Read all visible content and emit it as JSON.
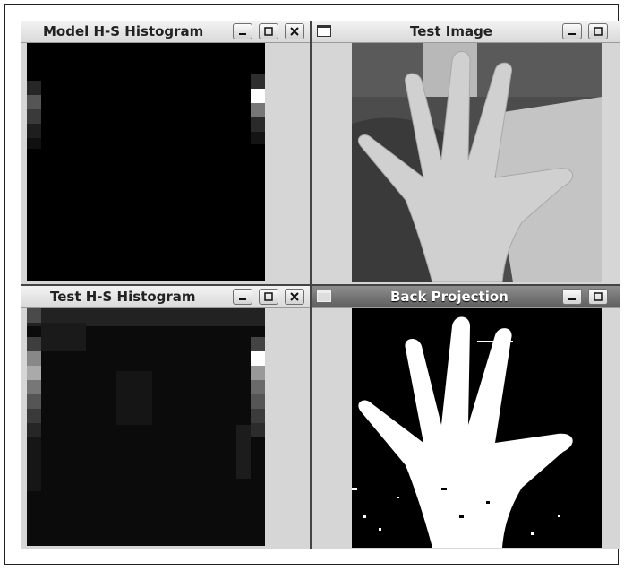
{
  "windows": {
    "model_hist": {
      "title": "Model H-S Histogram"
    },
    "test_image": {
      "title": "Test Image"
    },
    "test_hist": {
      "title": "Test H-S Histogram"
    },
    "back_proj": {
      "title": "Back Projection",
      "active": true
    }
  },
  "icons": [
    "minimize-icon",
    "maximize-icon",
    "close-icon",
    "window-menu-icon"
  ],
  "colors": {
    "titlebar_inactive": "#e6e6e6",
    "titlebar_active": "#6e6e6e",
    "histogram_bg": "#000000"
  }
}
